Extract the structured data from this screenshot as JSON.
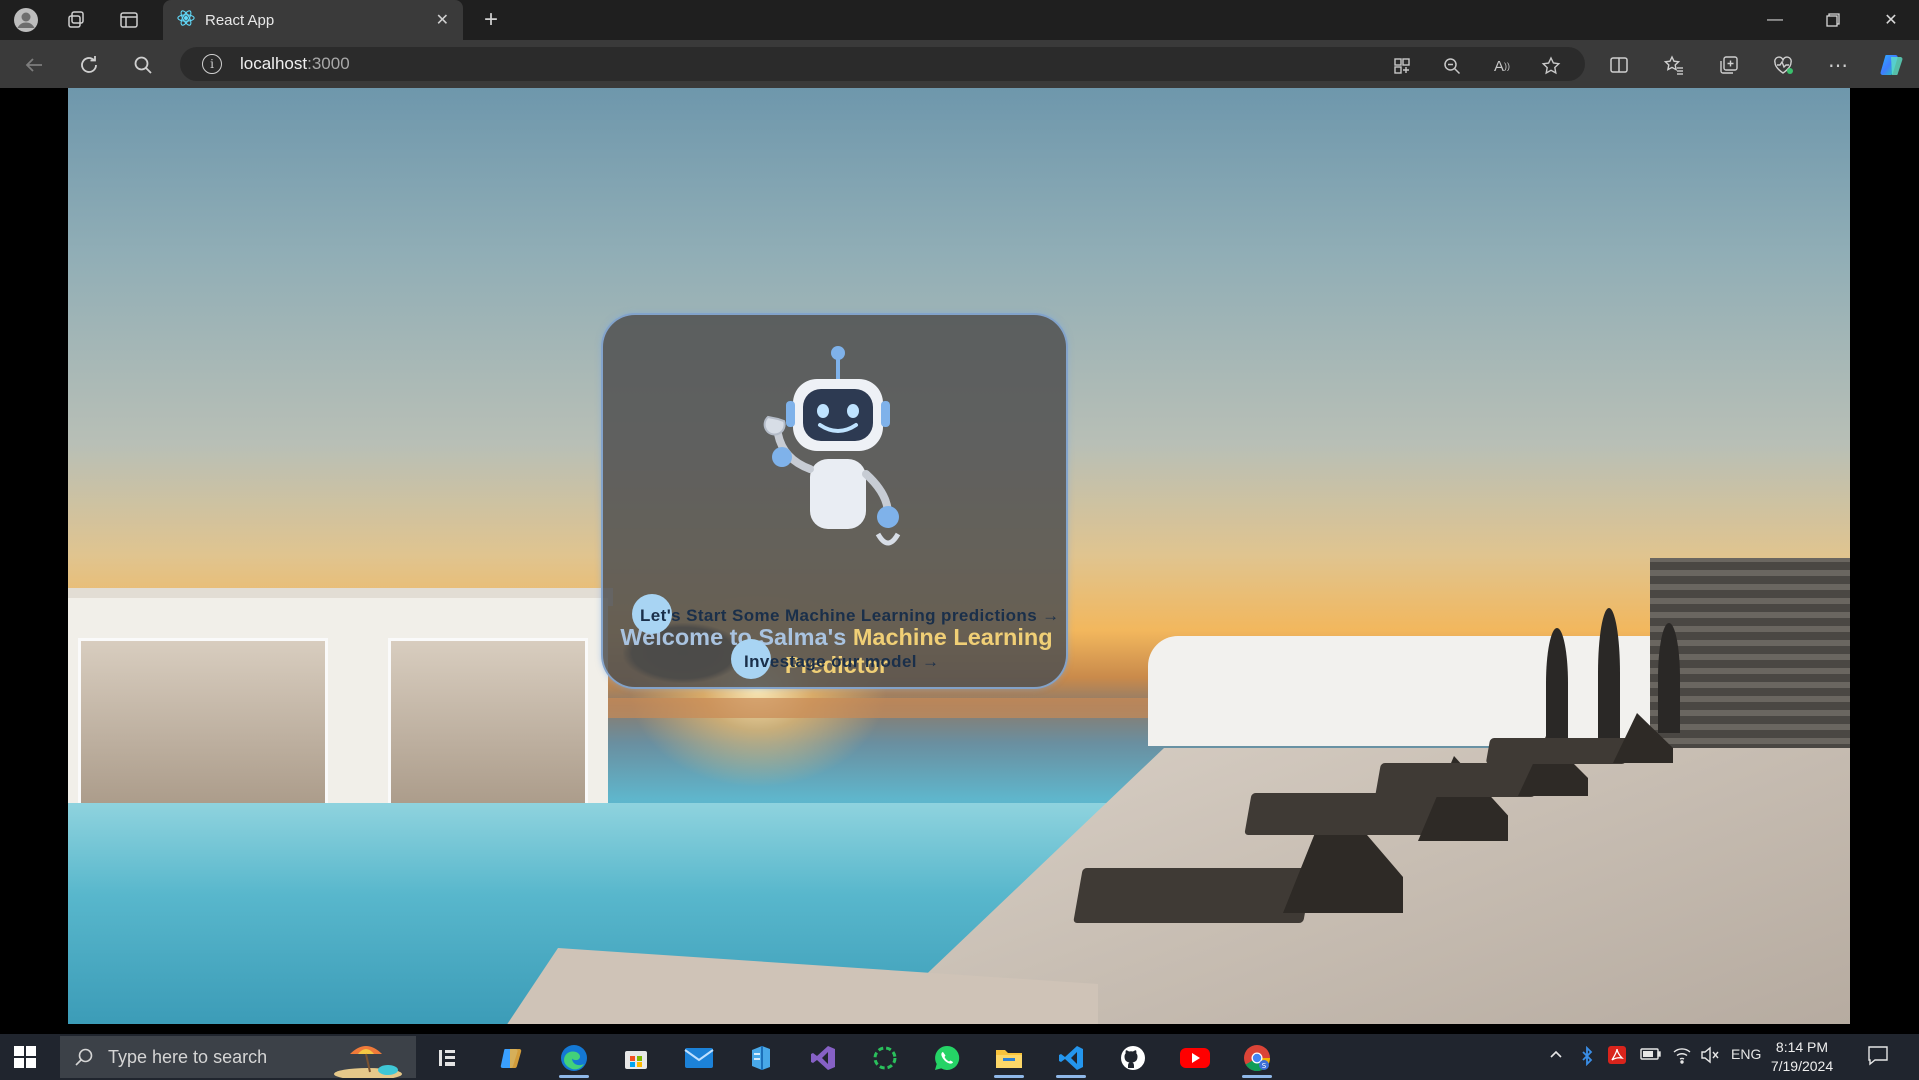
{
  "browser": {
    "tab_title": "React App",
    "address_host": "localhost",
    "address_port": ":3000"
  },
  "page": {
    "welcome_prefix": "Welcome to Salma's",
    "welcome_accent": "Machine Learning Predictor",
    "cta_primary": "Let's Start Some Machine Learning predictions →",
    "cta_secondary": "Investage our model →",
    "accent_color": "#f0cf76"
  },
  "taskbar": {
    "search_placeholder": "Type here to search",
    "language": "ENG",
    "time": "8:14 PM",
    "date": "7/19/2024",
    "pinned_apps": [
      "copilot-icon",
      "edge-icon",
      "store-icon",
      "mail-icon",
      "azure-data-studio-icon",
      "visual-studio-icon",
      "refresh-app-icon",
      "whatsapp-icon",
      "file-explorer-icon",
      "vscode-icon",
      "github-icon",
      "youtube-icon",
      "chrome-icon"
    ]
  }
}
